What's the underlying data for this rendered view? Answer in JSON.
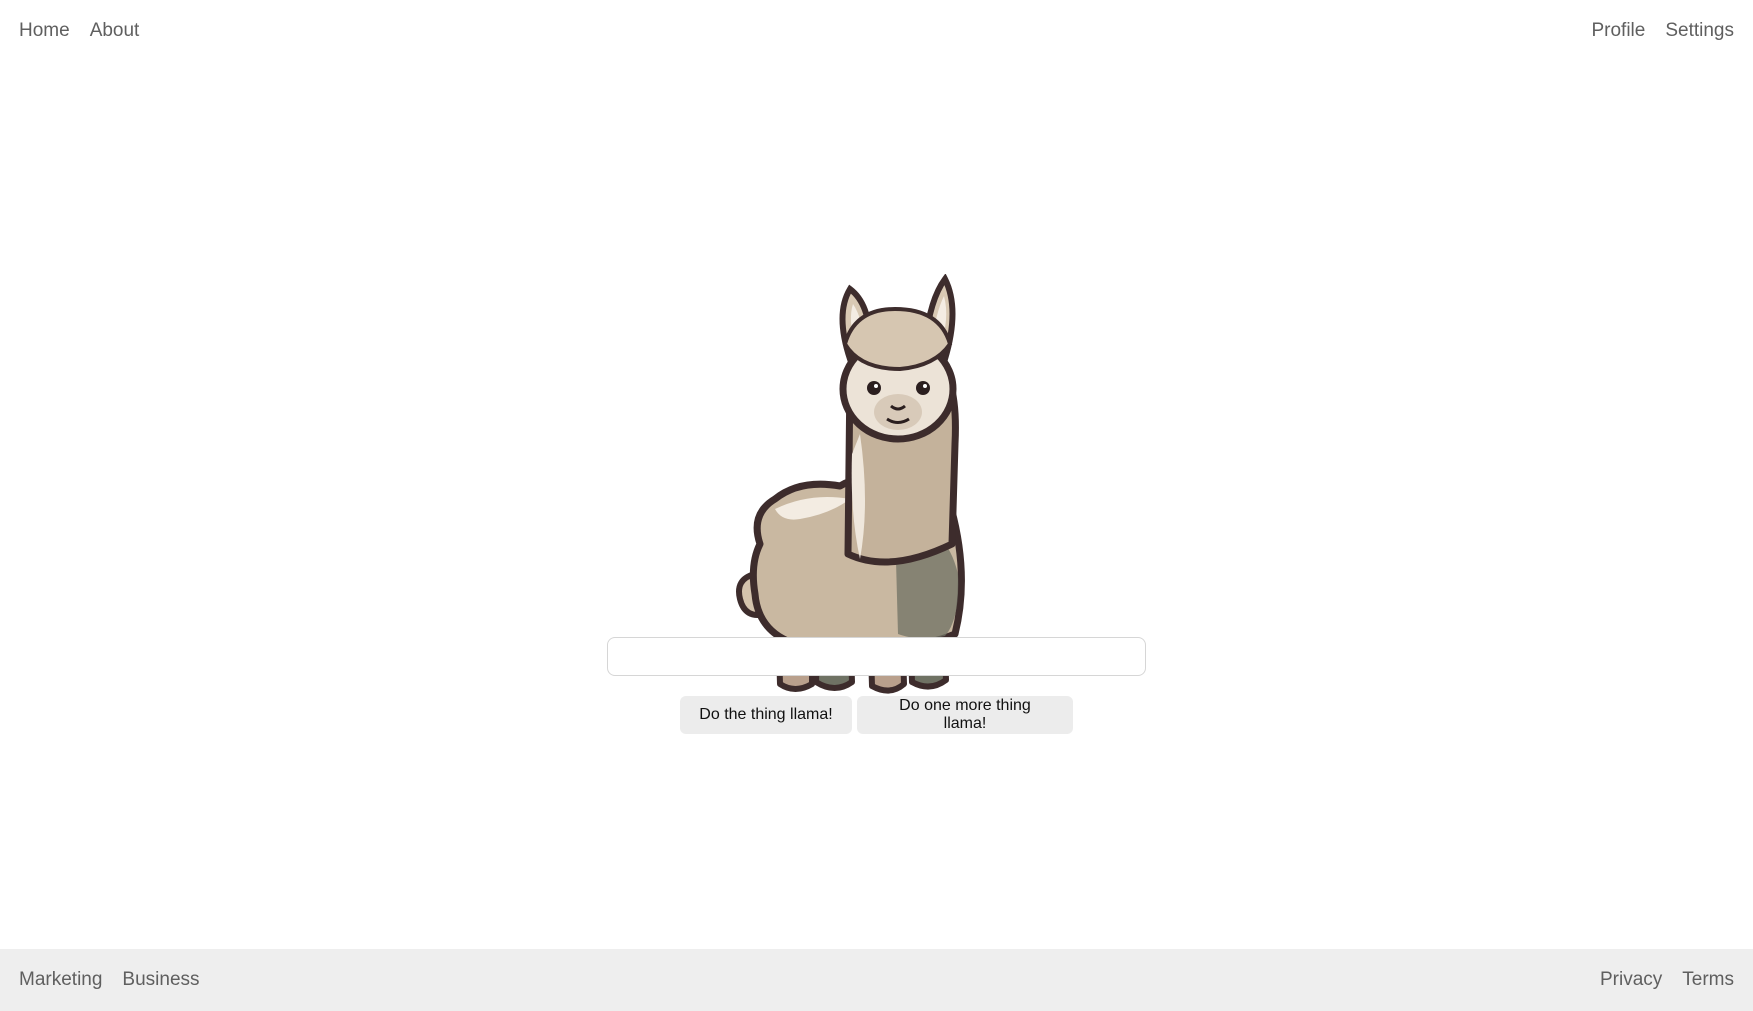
{
  "header": {
    "left_links": [
      {
        "label": "Home"
      },
      {
        "label": "About"
      }
    ],
    "right_links": [
      {
        "label": "Profile"
      },
      {
        "label": "Settings"
      }
    ]
  },
  "main": {
    "illustration": "llama-illustration",
    "prompt_input": {
      "value": "",
      "placeholder": ""
    },
    "buttons": [
      {
        "label": "Do the thing llama!"
      },
      {
        "label": "Do one more thing llama!"
      }
    ]
  },
  "footer": {
    "left_links": [
      {
        "label": "Marketing"
      },
      {
        "label": "Business"
      }
    ],
    "right_links": [
      {
        "label": "Privacy"
      },
      {
        "label": "Terms"
      }
    ]
  },
  "colors": {
    "footer_bg": "#eeeeee",
    "button_bg": "#ececec",
    "link_text": "#5f5f5f"
  }
}
